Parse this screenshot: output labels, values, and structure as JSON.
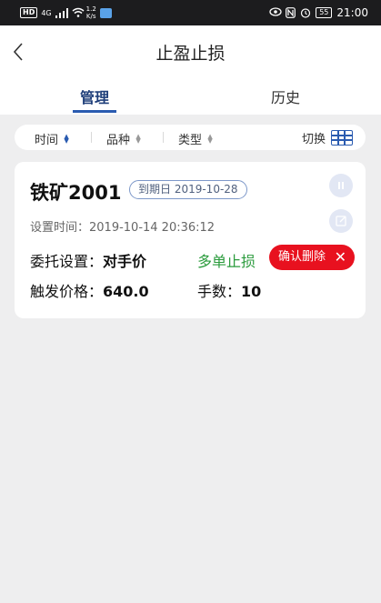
{
  "status_bar": {
    "hd": "HD",
    "network": "4G",
    "speed_value": "1.2",
    "speed_unit": "K/s",
    "battery": "55",
    "time": "21:00"
  },
  "nav": {
    "title": "止盈止损"
  },
  "tabs": [
    {
      "label": "管理",
      "active": true
    },
    {
      "label": "历史",
      "active": false
    }
  ],
  "filters": {
    "time_label": "时间",
    "variety_label": "品种",
    "type_label": "类型",
    "switch_label": "切换"
  },
  "order": {
    "contract": "铁矿2001",
    "expiry": "到期日 2019-10-28",
    "set_time": "设置时间：2019-10-14 20:36:12",
    "entrust_label": "委托设置：",
    "entrust_value": "对手价",
    "direction": "多单止损",
    "trigger_label": "触发价格：",
    "trigger_value": "640.0",
    "quantity_label": "手数：",
    "quantity_value": "10",
    "delete_label": "确认删除"
  },
  "colors": {
    "accent": "#2a5bb0",
    "delete": "#e8111f",
    "direction": "#2a9b3c"
  }
}
